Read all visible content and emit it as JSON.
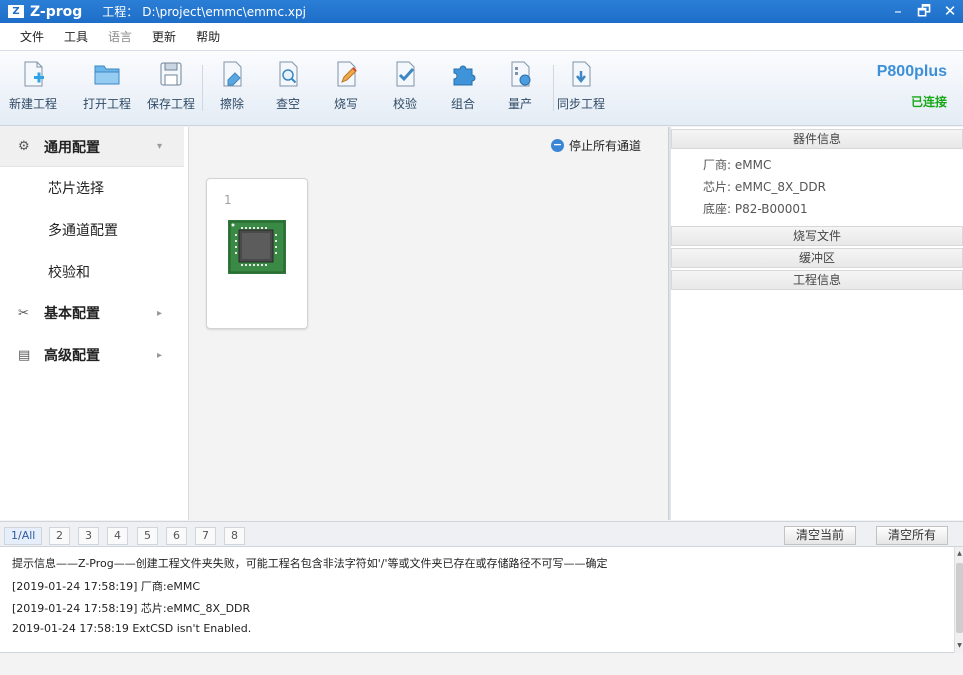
{
  "window": {
    "logo": "Z",
    "app_name": "Z-prog",
    "project_label": "工程：",
    "project_path": "D:\\project\\emmc\\emmc.xpj",
    "minimize": "–",
    "restore": "🗗",
    "close": "✕"
  },
  "menu": [
    "文件",
    "工具",
    "语言",
    "更新",
    "帮助"
  ],
  "toolbar": {
    "buttons": [
      "新建工程",
      "打开工程",
      "保存工程",
      "擦除",
      "查空",
      "烧写",
      "校验",
      "组合",
      "量产",
      "同步工程"
    ],
    "device": "P800plus",
    "status": "已连接",
    "status_color": "#17a817",
    "accent_color": "#3c8fd8"
  },
  "nav": {
    "sections": [
      {
        "label": "通用配置",
        "icon": "gear-icon",
        "arrow": "▾"
      },
      {
        "label": "基本配置",
        "icon": "tools-icon",
        "arrow": "▸"
      },
      {
        "label": "高级配置",
        "icon": "advanced-icon",
        "arrow": "▸"
      }
    ],
    "subitems": [
      "芯片选择",
      "多通道配置",
      "校验和"
    ]
  },
  "center": {
    "stop_all": "停止所有通道",
    "channel_number": "1"
  },
  "info": {
    "device_header": "器件信息",
    "vendor": "厂商: eMMC",
    "chip": "芯片: eMMC_8X_DDR",
    "socket": "底座: P82-B00001",
    "burn_file_header": "烧写文件",
    "buffer_header": "缓冲区",
    "project_header": "工程信息"
  },
  "log": {
    "tabs": [
      "1/All",
      "2",
      "3",
      "4",
      "5",
      "6",
      "7",
      "8"
    ],
    "clear_current": "清空当前",
    "clear_all": "清空所有",
    "lines": [
      "提示信息——Z-Prog——创建工程文件夹失败，可能工程名包含非法字符如'/'等或文件夹已存在或存储路径不可写——确定",
      "[2019-01-24 17:58:19] 厂商:eMMC",
      "[2019-01-24 17:58:19] 芯片:eMMC_8X_DDR",
      "2019-01-24 17:58:19 ExtCSD isn't Enabled."
    ]
  }
}
